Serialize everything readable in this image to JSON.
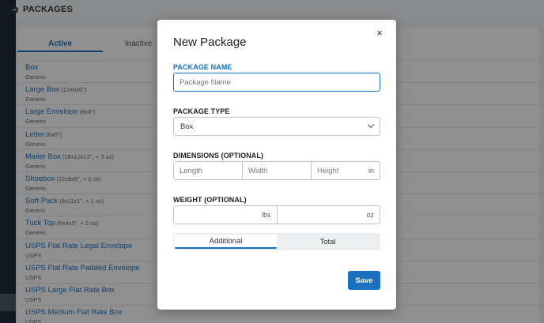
{
  "header": {
    "title": "PACKAGES"
  },
  "tabs": [
    {
      "label": "Active"
    },
    {
      "label": "Inactive"
    }
  ],
  "packages": [
    {
      "name": "Box",
      "dims": "",
      "carrier": "Generic"
    },
    {
      "name": "Large Box",
      "dims": "(12x6x6\")",
      "carrier": "Generic"
    },
    {
      "name": "Large Envelope",
      "dims": "(8x8\")",
      "carrier": "Generic"
    },
    {
      "name": "Letter",
      "dims": "(6x6\")",
      "carrier": "Generic"
    },
    {
      "name": "Mailer Box",
      "dims": "(18x12x12\", + 3 oz)",
      "carrier": "Generic"
    },
    {
      "name": "Shoebox",
      "dims": "(12x8x5\", + 2 oz)",
      "carrier": "Generic"
    },
    {
      "name": "Soft-Pack",
      "dims": "(9x11x1\", + 1 oz)",
      "carrier": "Generic"
    },
    {
      "name": "Tuck Top",
      "dims": "(6x4x3\", + 2 oz)",
      "carrier": "Generic"
    },
    {
      "name": "USPS Flat Rate Legal Envelope",
      "dims": "",
      "carrier": "USPS"
    },
    {
      "name": "USPS Flat Rate Padded Envelope",
      "dims": "",
      "carrier": "USPS"
    },
    {
      "name": "USPS Large Flat Rate Box",
      "dims": "",
      "carrier": "USPS"
    },
    {
      "name": "USPS Medium Flat Rate Box",
      "dims": "",
      "carrier": "USPS"
    }
  ],
  "modal": {
    "title": "New Package",
    "close_label": "×",
    "package_name_label": "PACKAGE NAME",
    "package_name_placeholder": "Package Name",
    "package_name_value": "",
    "package_type_label": "PACKAGE TYPE",
    "package_type_value": "Box",
    "dimensions_label": "DIMENSIONS (OPTIONAL)",
    "length_placeholder": "Length",
    "width_placeholder": "Width",
    "height_placeholder": "Height",
    "dimension_unit": "in",
    "weight_label": "WEIGHT (OPTIONAL)",
    "weight_lbs_unit": "lbs",
    "weight_oz_unit": "oz",
    "toggle_additional": "Additional",
    "toggle_total": "Total",
    "save_label": "Save"
  },
  "colors": {
    "accent": "#1a6fbf",
    "nav": "#1f2a36"
  }
}
